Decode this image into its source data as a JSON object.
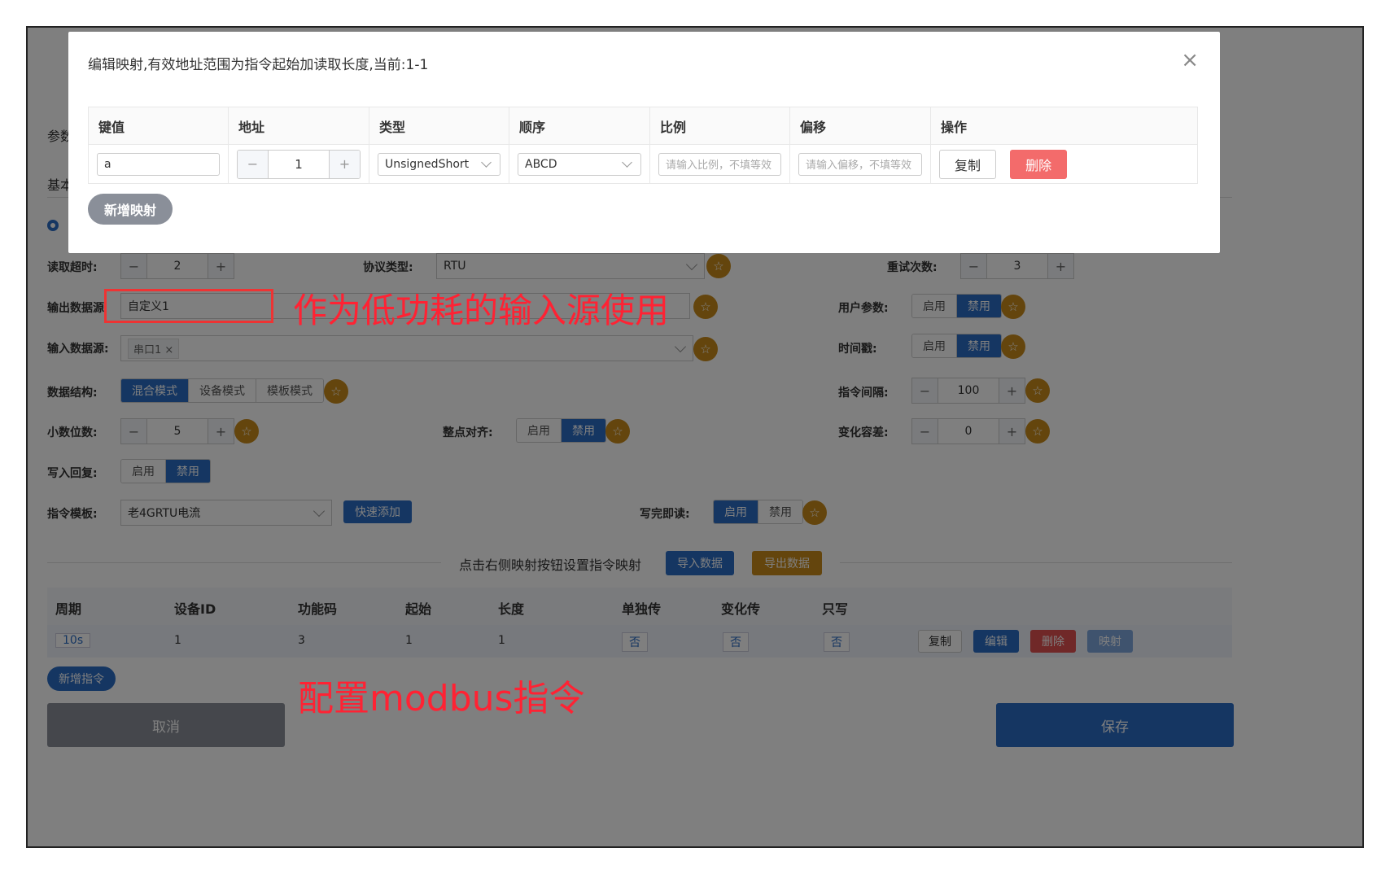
{
  "modal": {
    "title": "编辑映射,有效地址范围为指令起始加读取长度,当前:1-1",
    "columns": [
      "键值",
      "地址",
      "类型",
      "顺序",
      "比例",
      "偏移",
      "操作"
    ],
    "row": {
      "key": "a",
      "address": "1",
      "type": "UnsignedShort",
      "order": "ABCD",
      "ratio_placeholder": "请输入比例，不填等效",
      "offset_placeholder": "请输入偏移，不填等效",
      "copy": "复制",
      "delete": "删除"
    },
    "add_mapping": "新增映射"
  },
  "bg": {
    "params_tab": "参数",
    "basic_tab": "基本",
    "read_timeout_label": "读取超时:",
    "read_timeout_value": "2",
    "protocol_label": "协议类型:",
    "protocol_value": "RTU",
    "retry_label": "重试次数:",
    "retry_value": "3",
    "output_label": "输出数据源",
    "output_value": "自定义1",
    "user_param_label": "用户参数:",
    "input_label": "输入数据源:",
    "input_tag": "串口1",
    "timestamp_label": "时间戳:",
    "struct_label": "数据结构:",
    "struct_options": [
      "混合模式",
      "设备模式",
      "模板模式"
    ],
    "interval_label": "指令间隔:",
    "interval_value": "100",
    "decimal_label": "小数位数:",
    "decimal_value": "5",
    "align_label": "整点对齐:",
    "tolerance_label": "变化容差:",
    "tolerance_value": "0",
    "write_reply_label": "写入回复:",
    "template_label": "指令模板:",
    "template_value": "老4GRTU电流",
    "quick_add": "快速添加",
    "write_read_label": "写完即读:",
    "enable": "启用",
    "disable": "禁用",
    "divider_text": "点击右侧映射按钮设置指令映射",
    "import": "导入数据",
    "export": "导出数据",
    "table_headers": [
      "周期",
      "设备ID",
      "功能码",
      "起始",
      "长度",
      "单独传",
      "变化传",
      "只写"
    ],
    "table_row": {
      "period": "10s",
      "device": "1",
      "func": "3",
      "start": "1",
      "length": "1",
      "single": "否",
      "change": "否",
      "write_only": "否"
    },
    "row_copy": "复制",
    "row_edit": "编辑",
    "row_delete": "删除",
    "row_map": "映射",
    "add_cmd": "新增指令",
    "cancel": "取消",
    "save": "保存"
  },
  "annotations": {
    "low_power": "作为低功耗的输入源使用",
    "modbus": "配置modbus指令"
  },
  "colors": {
    "primary": "#2b6cc4",
    "star": "#c88a1a",
    "danger": "#f36b6b",
    "annotation": "#ff2222"
  }
}
